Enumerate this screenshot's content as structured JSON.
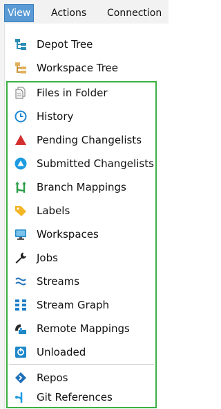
{
  "menubar": {
    "items": [
      {
        "label": "View",
        "active": true
      },
      {
        "label": "Actions",
        "active": false
      },
      {
        "label": "Connection",
        "active": false
      }
    ]
  },
  "menu": {
    "items": [
      {
        "label": "Depot Tree",
        "icon": "depot-tree-icon"
      },
      {
        "label": "Workspace Tree",
        "icon": "workspace-tree-icon"
      },
      {
        "label": "Files in Folder",
        "icon": "files-icon"
      },
      {
        "label": "History",
        "icon": "clock-icon"
      },
      {
        "label": "Pending Changelists",
        "icon": "triangle-icon"
      },
      {
        "label": "Submitted Changelists",
        "icon": "submitted-icon"
      },
      {
        "label": "Branch Mappings",
        "icon": "branch-icon"
      },
      {
        "label": "Labels",
        "icon": "tag-icon"
      },
      {
        "label": "Workspaces",
        "icon": "monitor-icon"
      },
      {
        "label": "Jobs",
        "icon": "wrench-icon"
      },
      {
        "label": "Streams",
        "icon": "streams-icon"
      },
      {
        "label": "Stream Graph",
        "icon": "stream-graph-icon"
      },
      {
        "label": "Remote Mappings",
        "icon": "remote-icon"
      },
      {
        "label": "Unloaded",
        "icon": "unloaded-icon"
      },
      {
        "label": "Repos",
        "icon": "diamond-icon"
      },
      {
        "label": "Git References",
        "icon": "git-icon"
      }
    ]
  },
  "colors": {
    "highlight_box": "#3cb043",
    "menu_active": "#5b9bd5"
  }
}
